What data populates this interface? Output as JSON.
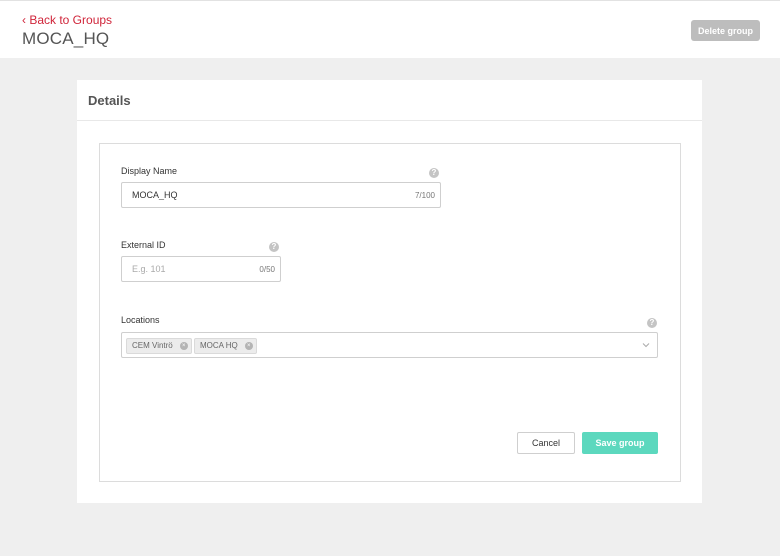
{
  "header": {
    "back_label": "‹ Back to Groups",
    "title": "MOCA_HQ",
    "delete_label": "Delete group"
  },
  "card": {
    "title": "Details"
  },
  "form": {
    "display_name": {
      "label": "Display Name",
      "value": "MOCA_HQ",
      "counter": "7/100",
      "help_icon": "?"
    },
    "external_id": {
      "label": "External ID",
      "value": "",
      "placeholder": "E.g. 101",
      "counter": "0/50",
      "help_icon": "?"
    },
    "locations": {
      "label": "Locations",
      "help_icon": "?",
      "chips": [
        "CEM Vintrö",
        "MOCA HQ"
      ],
      "chip_remove": "×"
    },
    "cancel_label": "Cancel",
    "save_label": "Save group"
  },
  "colors": {
    "accent_red": "#d0253a",
    "save_green": "#5cd8be",
    "delete_gray": "#bdbdbd"
  }
}
